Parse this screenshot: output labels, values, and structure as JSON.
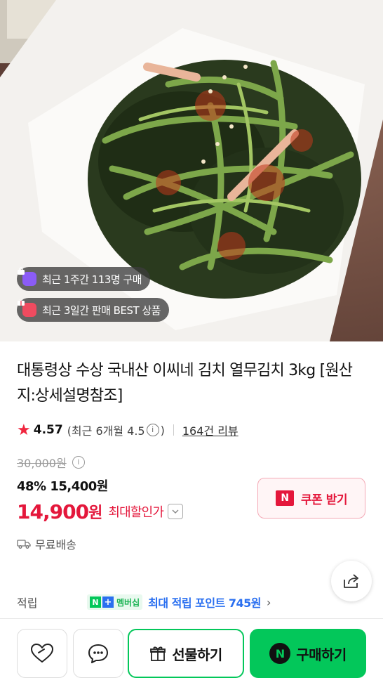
{
  "hero": {
    "badges": [
      {
        "icon": "shopping-bag-icon",
        "text": "최근 1주간 113명 구매",
        "color": "#8b5cf6"
      },
      {
        "icon": "gift-icon",
        "text": "최근 3일간 판매 BEST 상품",
        "color": "#ef4b5f"
      }
    ]
  },
  "product": {
    "title": "대통령상 수상 국내산 이씨네 김치 열무김치 3kg [원산지:상세설명참조]",
    "rating": {
      "score": "4.57",
      "recent": "(최근 6개월 4.5",
      "recent_close": ")",
      "reviews": "164건 리뷰"
    },
    "original_price": "30,000원",
    "discount_line": "48% 15,400원",
    "final_price": "14,900",
    "final_unit": "원",
    "max_discount_label": "최대할인가",
    "coupon_n": "N",
    "coupon_label": "쿠폰 받기",
    "shipping": "무료배송"
  },
  "points": {
    "label": "적립",
    "badge_n": "N",
    "badge_plus": "+",
    "badge_text": "멤버십",
    "text": "최대 적립 포인트 745원"
  },
  "actions": {
    "gift_label": "선물하기",
    "buy_n": "N",
    "buy_label": "구매하기"
  },
  "colors": {
    "accent_red": "#e4173b",
    "naver_green": "#03c75a",
    "point_blue": "#2a6ff0"
  }
}
